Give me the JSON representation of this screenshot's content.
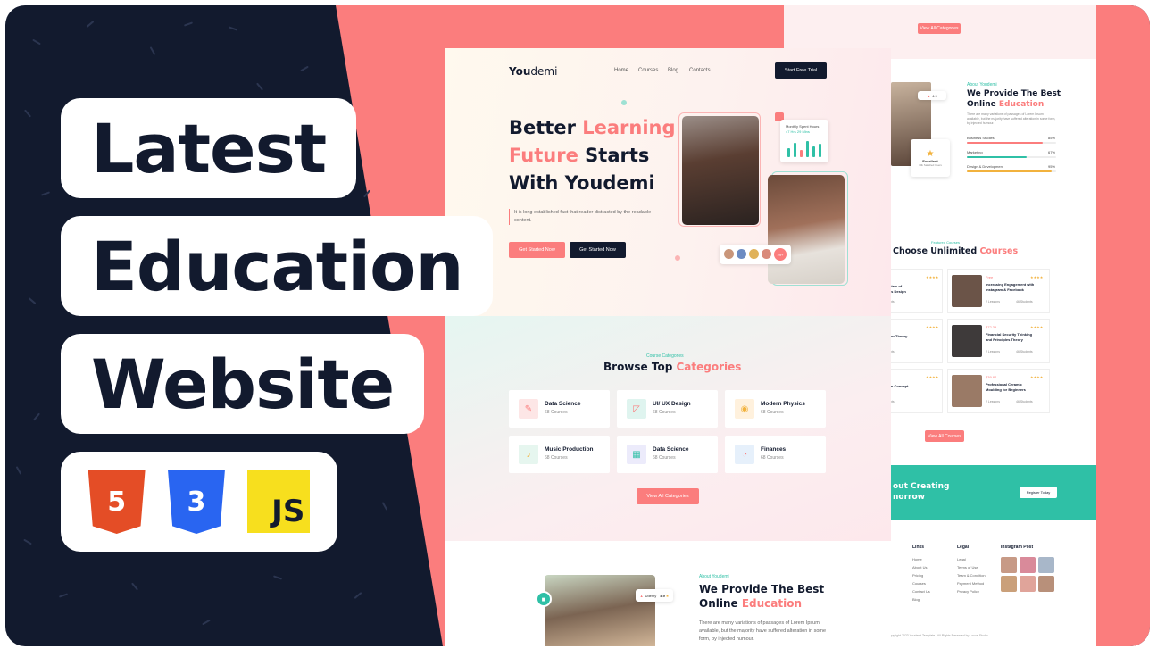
{
  "thumbnail": {
    "title_lines": [
      "Latest",
      "Education",
      "Website"
    ],
    "tech_badges": [
      {
        "icon": "html5-icon",
        "glyph": "5",
        "color": "#e44d26"
      },
      {
        "icon": "css3-icon",
        "glyph": "3",
        "color": "#2965f1"
      },
      {
        "icon": "javascript-icon",
        "glyph": "JS",
        "color": "#f7df1e"
      }
    ],
    "colors": {
      "navy": "#121a2e",
      "salmon": "#fb7d7d",
      "teal": "#2fc0a6"
    }
  },
  "site": {
    "logo": {
      "part1": "You",
      "part2": "demi"
    },
    "nav": [
      "Home",
      "Courses",
      "Blog",
      "Contacts"
    ],
    "cta_trial": "Start Free Trial",
    "hero": {
      "line1_a": "Better ",
      "line1_b": "Learning",
      "line2_a": "Future",
      "line2_b": " Starts",
      "line3": "With Youdemi",
      "description": "It is long established fact that reader distracted by the readable content.",
      "btn_primary": "Get Started Now",
      "btn_secondary": "Get Started Now",
      "stat_title": "Monthly Spent Hours",
      "stat_value": "47 Hrs 29 Mins",
      "avatars_more": "29+"
    },
    "categories": {
      "eyebrow": "Course Categories",
      "title_a": "Browse Top ",
      "title_b": "Categories",
      "items": [
        {
          "name": "Data Science",
          "count": "68 Courses",
          "icon": "pencil-ruler-icon"
        },
        {
          "name": "UI/ UX Design",
          "count": "68 Courses",
          "icon": "pen-tool-icon"
        },
        {
          "name": "Modern Physics",
          "count": "68 Courses",
          "icon": "atom-icon"
        },
        {
          "name": "Music Production",
          "count": "68 Courses",
          "icon": "music-icon"
        },
        {
          "name": "Data Science",
          "count": "68 Courses",
          "icon": "chart-icon"
        },
        {
          "name": "Finances",
          "count": "68 Courses",
          "icon": "finance-icon"
        }
      ],
      "view_all": "View All Categories"
    },
    "about": {
      "eyebrow": "About Youdemi",
      "title_a": "We Provide The Best",
      "title_b": "Online ",
      "title_c": "Education",
      "chip_brand": "Udemy",
      "chip_rating": "4.9",
      "description": "There are many variations of passages of Lorem Ipsum available, but the majority have suffered alteration in some form, by injected humour."
    }
  },
  "back_page": {
    "view_all_categories": "View All Categories",
    "about_eyebrow": "About Youdemi",
    "about_title_a": "We Provide The Best",
    "about_title_b": "Online ",
    "about_title_c": "Education",
    "about_desc": "There are many variations of passages of Lorem Ipsum available, but the majority have suffered alteration in some form, by injected humour.",
    "chip_rating": "4.9",
    "excellent": "Excellent",
    "excellent_sub": "10k Satisfied Users",
    "skills": [
      {
        "name": "Business Studies",
        "pct": "85%",
        "value": 0.85,
        "color": "#fb7d7d"
      },
      {
        "name": "Marketing",
        "pct": "67%",
        "value": 0.67,
        "color": "#2fc0a6"
      },
      {
        "name": "Design & Development",
        "pct": "95%",
        "value": 0.95,
        "color": "#f2b23d"
      }
    ],
    "courses_eyebrow": "Featured Courses",
    "courses_title_a": "Choose Unlimited ",
    "courses_title_b": "Courses",
    "courses_left": [
      {
        "title_1": "ndamentals of",
        "title_2": "Graphics Design",
        "students": "46 Students"
      },
      {
        "title_1": "n to Color Theory",
        "title_2": "UX",
        "students": "46 Students"
      },
      {
        "title_1": "gn: From Concept",
        "title_2": "ation",
        "students": "46 Students"
      }
    ],
    "courses_right": [
      {
        "price": "Free",
        "title_1": "Increasing Engagement with",
        "title_2": "Instagram & Facebook",
        "lessons": "2 Lessons",
        "students": "46 Students"
      },
      {
        "price": "$72.39",
        "title_1": "Financial Security Thinking",
        "title_2": "and Principles Theory",
        "lessons": "2 Lessons",
        "students": "46 Students"
      },
      {
        "price": "$39.82",
        "title_1": "Professional Ceramic",
        "title_2": "Moulding for Beginners",
        "lessons": "2 Lessons",
        "students": "46 Students"
      }
    ],
    "view_all_courses": "View All Courses",
    "banner_line1": "out Creating",
    "banner_line2": "norrow",
    "register": "Register Today",
    "footer": {
      "links_title": "Links",
      "links": [
        "Home",
        "About Us",
        "Pricing",
        "Courses",
        "Contact Us",
        "Blog"
      ],
      "legal_title": "Legal",
      "legal": [
        "Legal",
        "Terms of Use",
        "Team & Condition",
        "Payment Method",
        "Privacy Policy"
      ],
      "instagram_title": "Instagram Post",
      "copyright": "Copyright 2023 Youdemi Template | All Rights Reserved by Lovue Studio"
    }
  }
}
